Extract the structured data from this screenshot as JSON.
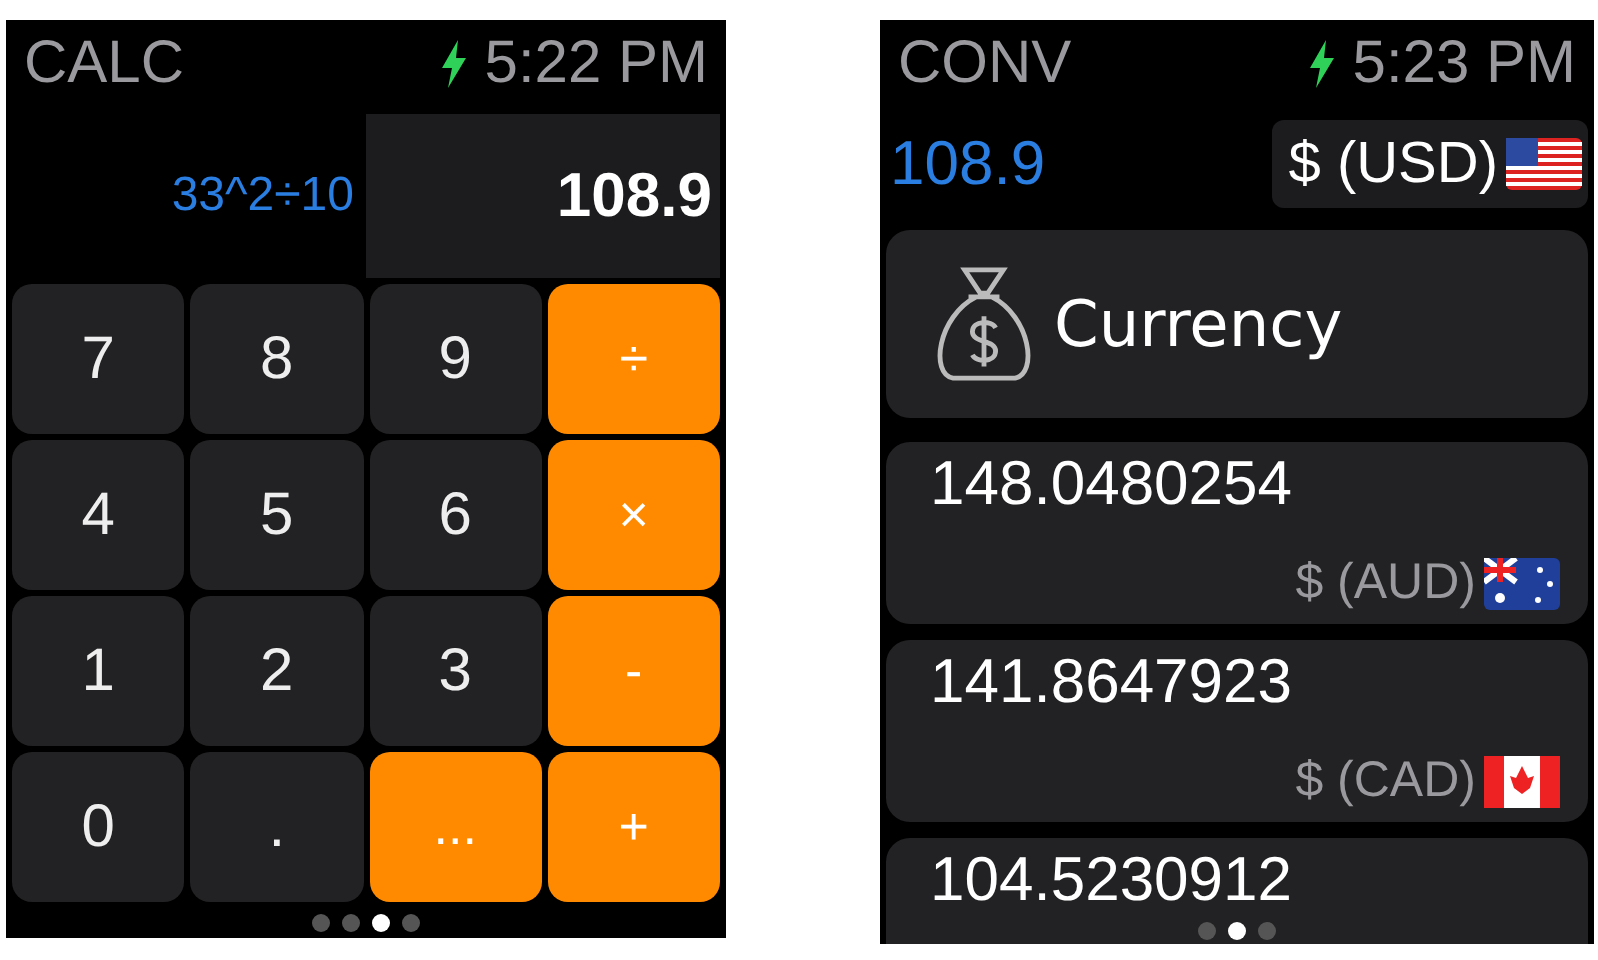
{
  "calc": {
    "title": "CALC",
    "time": "5:22 PM",
    "expression": "33^2÷10",
    "result": "108.9",
    "keys": [
      {
        "label": "7",
        "kind": "digit"
      },
      {
        "label": "8",
        "kind": "digit"
      },
      {
        "label": "9",
        "kind": "digit"
      },
      {
        "label": "÷",
        "kind": "operator"
      },
      {
        "label": "4",
        "kind": "digit"
      },
      {
        "label": "5",
        "kind": "digit"
      },
      {
        "label": "6",
        "kind": "digit"
      },
      {
        "label": "×",
        "kind": "operator"
      },
      {
        "label": "1",
        "kind": "digit"
      },
      {
        "label": "2",
        "kind": "digit"
      },
      {
        "label": "3",
        "kind": "digit"
      },
      {
        "label": "-",
        "kind": "operator"
      },
      {
        "label": "0",
        "kind": "digit"
      },
      {
        "label": ".",
        "kind": "digit"
      },
      {
        "label": "...",
        "kind": "operator"
      },
      {
        "label": "+",
        "kind": "operator"
      }
    ],
    "page_dots": [
      {
        "selected": false
      },
      {
        "selected": false
      },
      {
        "selected": true
      },
      {
        "selected": false
      }
    ]
  },
  "conv": {
    "title": "CONV",
    "time": "5:23 PM",
    "amount": "108.9",
    "source_currency": {
      "label": "$ (USD)",
      "kind": "us"
    },
    "category": "Currency",
    "results": [
      {
        "value": "148.0480254",
        "currency": "$ (AUD)",
        "kind": "au"
      },
      {
        "value": "141.8647923",
        "currency": "$ (CAD)",
        "kind": "ca"
      },
      {
        "value": "104.5230912"
      }
    ],
    "page_dots": [
      {
        "selected": false
      },
      {
        "selected": true
      },
      {
        "selected": false
      }
    ]
  }
}
